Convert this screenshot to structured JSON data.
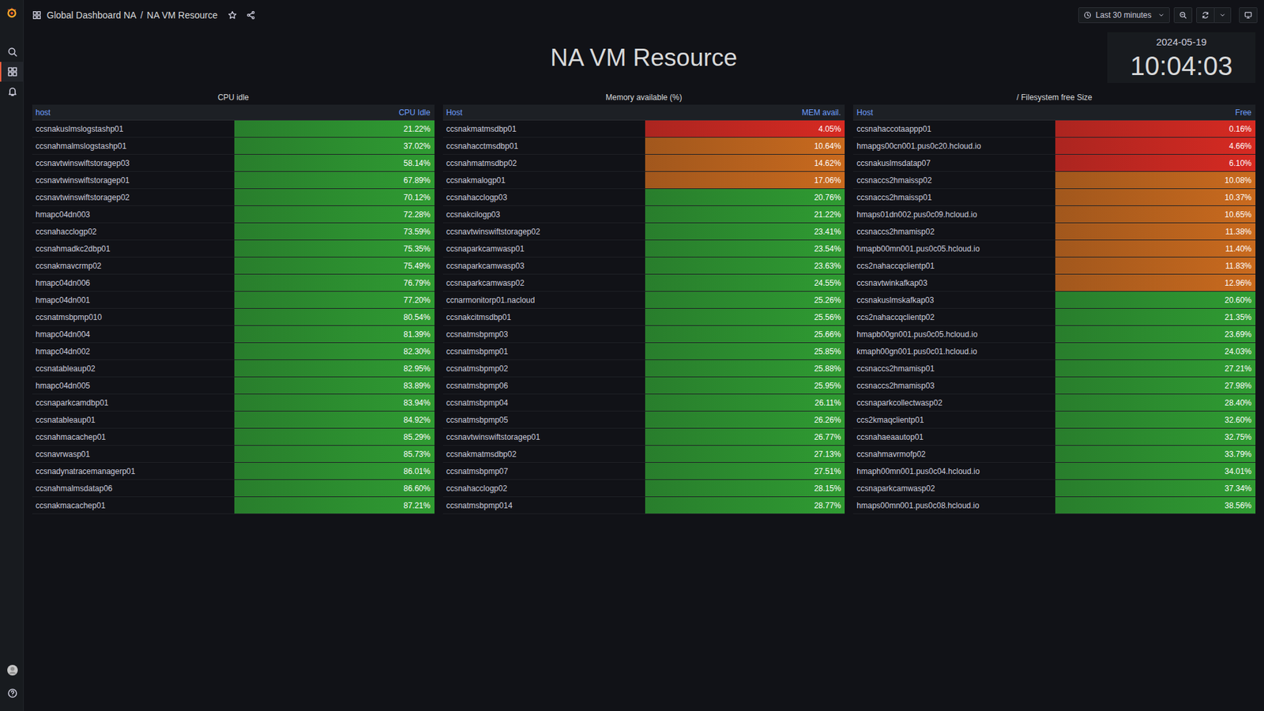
{
  "sidebar": {
    "items": [
      {
        "selected": false
      },
      {
        "selected": true
      },
      {
        "selected": false
      },
      {
        "selected": false
      },
      {
        "selected": false
      }
    ]
  },
  "nav": {
    "breadcrumb": [
      "Global Dashboard NA",
      "NA VM Resource"
    ],
    "separator": "/",
    "starred": false,
    "time_range": "Last 30 minutes"
  },
  "title": "NA VM Resource",
  "clock": {
    "date": "2024-05-19",
    "time": "10:04:03"
  },
  "panels": [
    {
      "title": "CPU idle",
      "columns": [
        "host",
        "CPU Idle"
      ],
      "rows": [
        {
          "host": "ccsnakuslmslogstashp01",
          "value": "21.22%",
          "color": "#2f9b32"
        },
        {
          "host": "ccsnahmalmslogstashp01",
          "value": "37.02%",
          "color": "#2f9b32"
        },
        {
          "host": "ccsnavtwinswiftstoragep03",
          "value": "58.14%",
          "color": "#2f9b32"
        },
        {
          "host": "ccsnavtwinswiftstoragep01",
          "value": "67.89%",
          "color": "#2f9b32"
        },
        {
          "host": "ccsnavtwinswiftstoragep02",
          "value": "70.12%",
          "color": "#2f9b32"
        },
        {
          "host": "hmapc04dn003",
          "value": "72.28%",
          "color": "#2f9b32"
        },
        {
          "host": "ccsnahacclogp02",
          "value": "73.59%",
          "color": "#2f9b32"
        },
        {
          "host": "ccsnahmadkc2dbp01",
          "value": "75.35%",
          "color": "#2f9b32"
        },
        {
          "host": "ccsnakmavcrmp02",
          "value": "75.49%",
          "color": "#2f9b32"
        },
        {
          "host": "hmapc04dn006",
          "value": "76.79%",
          "color": "#2f9b32"
        },
        {
          "host": "hmapc04dn001",
          "value": "77.20%",
          "color": "#2f9b32"
        },
        {
          "host": "ccsnatmsbpmp010",
          "value": "80.54%",
          "color": "#2f9b32"
        },
        {
          "host": "hmapc04dn004",
          "value": "81.39%",
          "color": "#2f9b32"
        },
        {
          "host": "hmapc04dn002",
          "value": "82.30%",
          "color": "#2f9b32"
        },
        {
          "host": "ccsnatableaup02",
          "value": "82.95%",
          "color": "#2f9b32"
        },
        {
          "host": "hmapc04dn005",
          "value": "83.89%",
          "color": "#2f9b32"
        },
        {
          "host": "ccsnaparkcamdbp01",
          "value": "83.94%",
          "color": "#2f9b32"
        },
        {
          "host": "ccsnatableaup01",
          "value": "84.92%",
          "color": "#2f9b32"
        },
        {
          "host": "ccsnahmacachep01",
          "value": "85.29%",
          "color": "#2f9b32"
        },
        {
          "host": "ccsnavrwasp01",
          "value": "85.73%",
          "color": "#2f9b32"
        },
        {
          "host": "ccsnadynatracemanagerp01",
          "value": "86.01%",
          "color": "#2f9b32"
        },
        {
          "host": "ccsnahmalmsdatap06",
          "value": "86.60%",
          "color": "#2f9b32"
        },
        {
          "host": "ccsnakmacachep01",
          "value": "87.21%",
          "color": "#2f9b32"
        }
      ]
    },
    {
      "title": "Memory available (%)",
      "columns": [
        "Host",
        "MEM avail."
      ],
      "rows": [
        {
          "host": "ccsnakmatmsdbp01",
          "value": "4.05%",
          "color": "#d62a22"
        },
        {
          "host": "ccsnahacctmsdbp01",
          "value": "10.64%",
          "color": "#c96a1e"
        },
        {
          "host": "ccsnahmatmsdbp02",
          "value": "14.62%",
          "color": "#c96a1e"
        },
        {
          "host": "ccsnakmalogp01",
          "value": "17.06%",
          "color": "#c96a1e"
        },
        {
          "host": "ccsnahacclogp03",
          "value": "20.76%",
          "color": "#2f9b32"
        },
        {
          "host": "ccsnakcilogp03",
          "value": "21.22%",
          "color": "#2f9b32"
        },
        {
          "host": "ccsnavtwinswiftstoragep02",
          "value": "23.41%",
          "color": "#2f9b32"
        },
        {
          "host": "ccsnaparkcamwasp01",
          "value": "23.54%",
          "color": "#2f9b32"
        },
        {
          "host": "ccsnaparkcamwasp03",
          "value": "23.63%",
          "color": "#2f9b32"
        },
        {
          "host": "ccsnaparkcamwasp02",
          "value": "24.55%",
          "color": "#2f9b32"
        },
        {
          "host": "ccnarmonitorp01.nacloud",
          "value": "25.26%",
          "color": "#2f9b32"
        },
        {
          "host": "ccsnakcitmsdbp01",
          "value": "25.56%",
          "color": "#2f9b32"
        },
        {
          "host": "ccsnatmsbpmp03",
          "value": "25.66%",
          "color": "#2f9b32"
        },
        {
          "host": "ccsnatmsbpmp01",
          "value": "25.85%",
          "color": "#2f9b32"
        },
        {
          "host": "ccsnatmsbpmp02",
          "value": "25.88%",
          "color": "#2f9b32"
        },
        {
          "host": "ccsnatmsbpmp06",
          "value": "25.95%",
          "color": "#2f9b32"
        },
        {
          "host": "ccsnatmsbpmp04",
          "value": "26.11%",
          "color": "#2f9b32"
        },
        {
          "host": "ccsnatmsbpmp05",
          "value": "26.26%",
          "color": "#2f9b32"
        },
        {
          "host": "ccsnavtwinswiftstoragep01",
          "value": "26.77%",
          "color": "#2f9b32"
        },
        {
          "host": "ccsnakmatmsdbp02",
          "value": "27.13%",
          "color": "#2f9b32"
        },
        {
          "host": "ccsnatmsbpmp07",
          "value": "27.51%",
          "color": "#2f9b32"
        },
        {
          "host": "ccsnahacclogp02",
          "value": "28.15%",
          "color": "#2f9b32"
        },
        {
          "host": "ccsnatmsbpmp014",
          "value": "28.77%",
          "color": "#2f9b32"
        }
      ]
    },
    {
      "title": "/ Filesystem free Size",
      "columns": [
        "Host",
        "Free"
      ],
      "rows": [
        {
          "host": "ccsnahaccotaappp01",
          "value": "0.16%",
          "color": "#d62a22"
        },
        {
          "host": "hmapgs00cn001.pus0c20.hcloud.io",
          "value": "4.66%",
          "color": "#d62a22"
        },
        {
          "host": "ccsnakuslmsdatap07",
          "value": "6.10%",
          "color": "#d62a22"
        },
        {
          "host": "ccsnaccs2hmaissp02",
          "value": "10.08%",
          "color": "#c96a1e"
        },
        {
          "host": "ccsnaccs2hmaissp01",
          "value": "10.37%",
          "color": "#c96a1e"
        },
        {
          "host": "hmaps01dn002.pus0c09.hcloud.io",
          "value": "10.65%",
          "color": "#c96a1e"
        },
        {
          "host": "ccsnaccs2hmamisp02",
          "value": "11.38%",
          "color": "#c96a1e"
        },
        {
          "host": "hmapb00mn001.pus0c05.hcloud.io",
          "value": "11.40%",
          "color": "#c96a1e"
        },
        {
          "host": "ccs2nahaccqclientp01",
          "value": "11.83%",
          "color": "#c96a1e"
        },
        {
          "host": "ccsnavtwinkafkap03",
          "value": "12.96%",
          "color": "#c96a1e"
        },
        {
          "host": "ccsnakuslmskafkap03",
          "value": "20.60%",
          "color": "#2f9b32"
        },
        {
          "host": "ccs2nahaccqclientp02",
          "value": "21.35%",
          "color": "#2f9b32"
        },
        {
          "host": "hmapb00gn001.pus0c05.hcloud.io",
          "value": "23.69%",
          "color": "#2f9b32"
        },
        {
          "host": "kmaph00gn001.pus0c01.hcloud.io",
          "value": "24.03%",
          "color": "#2f9b32"
        },
        {
          "host": "ccsnaccs2hmamisp01",
          "value": "27.21%",
          "color": "#2f9b32"
        },
        {
          "host": "ccsnaccs2hmamisp03",
          "value": "27.98%",
          "color": "#2f9b32"
        },
        {
          "host": "ccsnaparkcollectwasp02",
          "value": "28.40%",
          "color": "#2f9b32"
        },
        {
          "host": "ccs2kmaqclientp01",
          "value": "32.60%",
          "color": "#2f9b32"
        },
        {
          "host": "ccsnahaeaautop01",
          "value": "32.75%",
          "color": "#2f9b32"
        },
        {
          "host": "ccsnahmavrmofp02",
          "value": "33.79%",
          "color": "#2f9b32"
        },
        {
          "host": "hmaph00mn001.pus0c04.hcloud.io",
          "value": "34.01%",
          "color": "#2f9b32"
        },
        {
          "host": "ccsnaparkcamwasp02",
          "value": "37.34%",
          "color": "#2f9b32"
        },
        {
          "host": "hmaps00mn001.pus0c08.hcloud.io",
          "value": "38.56%",
          "color": "#2f9b32"
        }
      ]
    }
  ]
}
